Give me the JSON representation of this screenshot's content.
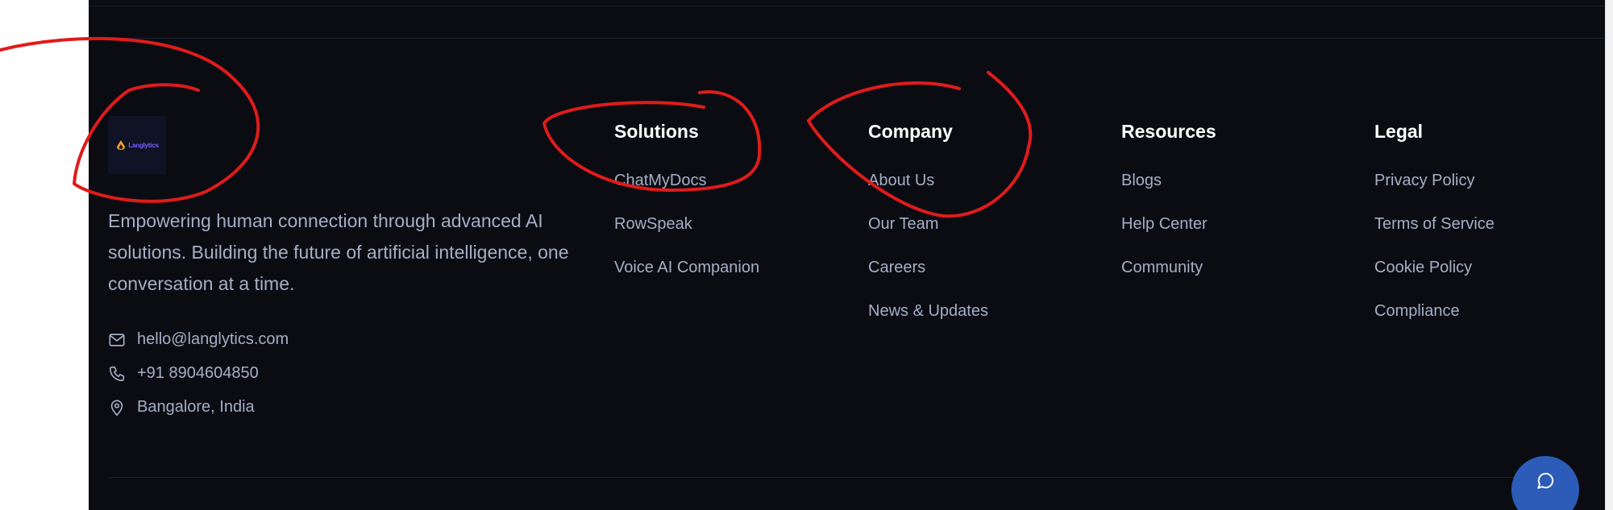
{
  "brand": {
    "logo_text": "Langlytics",
    "description": "Empowering human connection through advanced AI solutions. Building the future of artificial intelligence, one conversation at a time."
  },
  "contact": {
    "email": "hello@langlytics.com",
    "phone": "+91 8904604850",
    "location": "Bangalore, India"
  },
  "columns": [
    {
      "heading": "Solutions",
      "links": [
        "ChatMyDocs",
        "RowSpeak",
        "Voice AI Companion"
      ]
    },
    {
      "heading": "Company",
      "links": [
        "About Us",
        "Our Team",
        "Careers",
        "News & Updates"
      ]
    },
    {
      "heading": "Resources",
      "links": [
        "Blogs",
        "Help Center",
        "Community"
      ]
    },
    {
      "heading": "Legal",
      "links": [
        "Privacy Policy",
        "Terms of Service",
        "Cookie Policy",
        "Compliance"
      ]
    }
  ],
  "colors": {
    "background": "#0b0c12",
    "heading": "#ffffff",
    "link": "#a4afc6",
    "accent": "#2c5bb8",
    "annotation": "#e01b1b"
  },
  "icons": {
    "email": "mail-icon",
    "phone": "phone-icon",
    "location": "map-pin-icon",
    "chat": "chat-bubble-icon"
  }
}
